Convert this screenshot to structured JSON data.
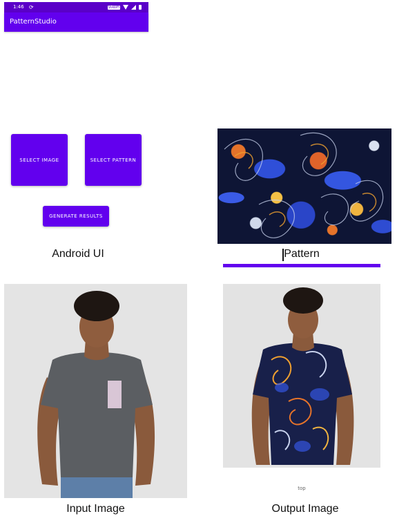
{
  "status_bar": {
    "time": "1:46",
    "sync_icon": "sync-icon",
    "vowifi": "VoWiFi"
  },
  "app_bar": {
    "title": "PatternStudio"
  },
  "buttons": {
    "select_image": "SELECT IMAGE",
    "select_pattern": "SELECT PATTERN",
    "generate_results": "GENERATE RESULTS"
  },
  "captions": {
    "android_ui": "Android UI",
    "pattern": "Pattern",
    "input_image": "Input Image",
    "output_image": "Output Image"
  },
  "output_panel": {
    "footer_text": "top"
  },
  "colors": {
    "primary": "#6200ee",
    "status_bar": "#5a00c8",
    "pattern_base": "#0e1535",
    "pattern_blue": "#3456e0",
    "pattern_orange": "#e5732a",
    "shirt_gray": "#5b5e62"
  }
}
